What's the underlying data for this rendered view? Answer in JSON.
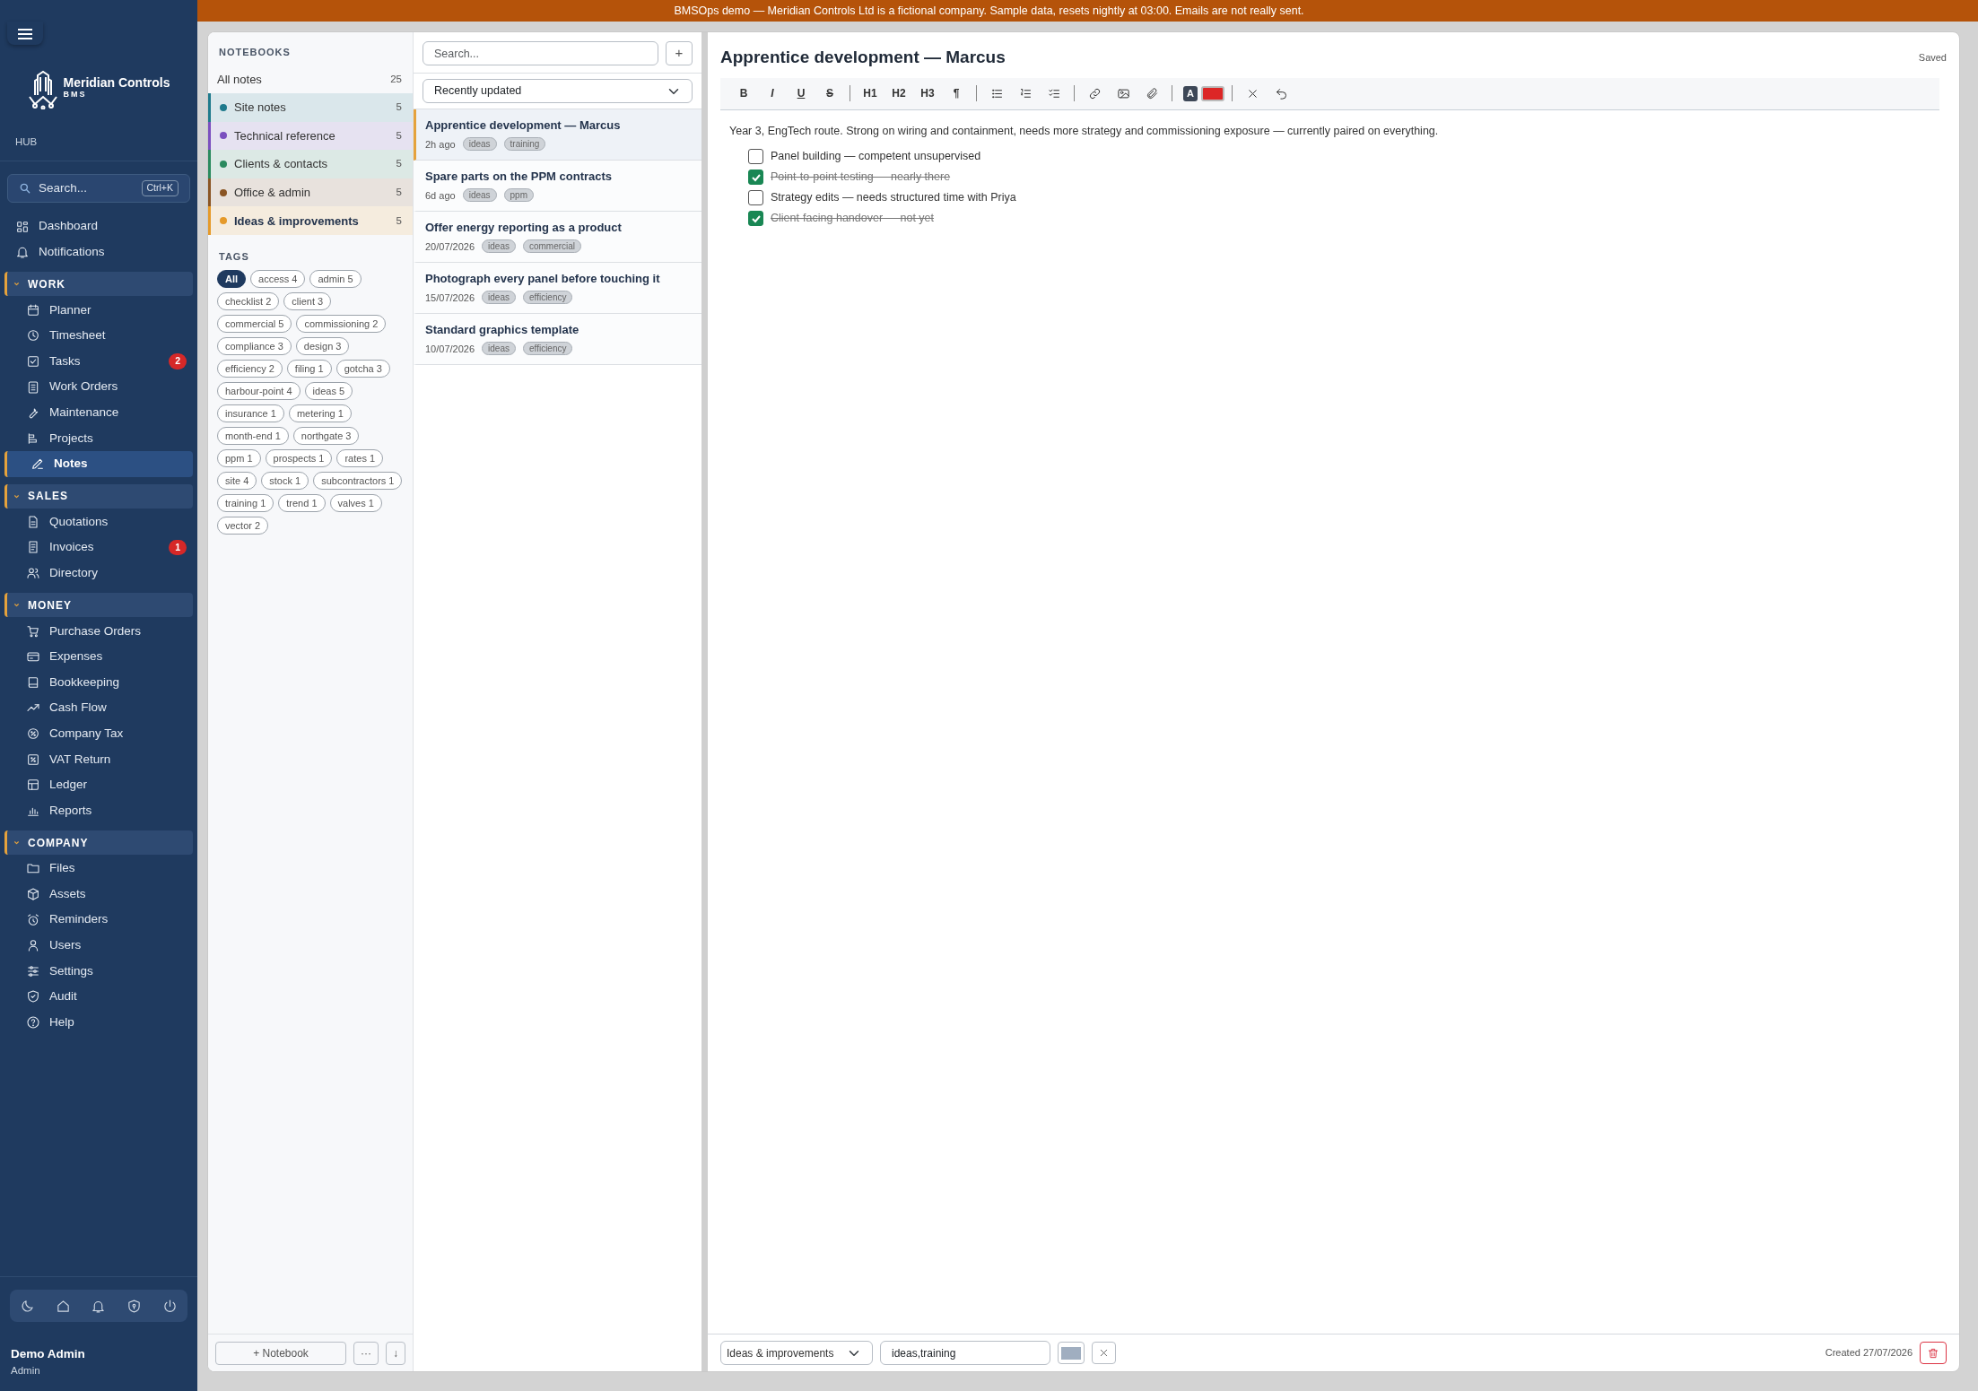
{
  "banner": "BMSOps demo — Meridian Controls Ltd is a fictional company. Sample data, resets nightly at 03:00. Emails are not really sent.",
  "sidebar": {
    "brand": {
      "name": "Meridian Controls",
      "sub": "BMS"
    },
    "hub_label": "HUB",
    "search": {
      "placeholder": "Search...",
      "shortcut": "Ctrl+K"
    },
    "top_items": [
      {
        "label": "Dashboard"
      },
      {
        "label": "Notifications"
      }
    ],
    "sections": [
      {
        "title": "WORK",
        "expanded": true,
        "items": [
          {
            "label": "Planner",
            "selected": false
          },
          {
            "label": "Timesheet",
            "selected": false
          },
          {
            "label": "Tasks",
            "selected": false,
            "badge": "2"
          },
          {
            "label": "Work Orders",
            "selected": false
          },
          {
            "label": "Maintenance",
            "selected": false
          },
          {
            "label": "Projects",
            "selected": false
          },
          {
            "label": "Notes",
            "selected": true
          }
        ]
      },
      {
        "title": "SALES",
        "expanded": true,
        "items": [
          {
            "label": "Quotations",
            "selected": false
          },
          {
            "label": "Invoices",
            "selected": false,
            "badge": "1"
          },
          {
            "label": "Directory",
            "selected": false
          }
        ]
      },
      {
        "title": "MONEY",
        "expanded": true,
        "items": [
          {
            "label": "Purchase Orders",
            "selected": false
          },
          {
            "label": "Expenses",
            "selected": false
          },
          {
            "label": "Bookkeeping",
            "selected": false
          },
          {
            "label": "Cash Flow",
            "selected": false
          },
          {
            "label": "Company Tax",
            "selected": false
          },
          {
            "label": "VAT Return",
            "selected": false
          },
          {
            "label": "Ledger",
            "selected": false
          },
          {
            "label": "Reports",
            "selected": false
          }
        ]
      },
      {
        "title": "COMPANY",
        "expanded": true,
        "items": [
          {
            "label": "Files",
            "selected": false
          },
          {
            "label": "Assets",
            "selected": false
          },
          {
            "label": "Reminders",
            "selected": false
          },
          {
            "label": "Users",
            "selected": false
          },
          {
            "label": "Settings",
            "selected": false
          },
          {
            "label": "Audit",
            "selected": false
          },
          {
            "label": "Help",
            "selected": false
          }
        ]
      }
    ],
    "user": {
      "name": "Demo Admin",
      "role": "Admin"
    }
  },
  "notebooks": {
    "heading": "NOTEBOOKS",
    "all": {
      "label": "All notes",
      "count": "25",
      "selected": false
    },
    "items": [
      {
        "label": "Site notes",
        "count": "5",
        "color": "#1f7a8c",
        "selected": false
      },
      {
        "label": "Technical reference",
        "count": "5",
        "color": "#7b4fbf",
        "selected": false
      },
      {
        "label": "Clients & contacts",
        "count": "5",
        "color": "#2a8a5e",
        "selected": false
      },
      {
        "label": "Office & admin",
        "count": "5",
        "color": "#8a5524",
        "selected": false
      },
      {
        "label": "Ideas & improvements",
        "count": "5",
        "color": "#e59a2a",
        "selected": true
      }
    ],
    "tags_heading": "TAGS",
    "tags": [
      {
        "label": "All",
        "selected": true
      },
      {
        "label": "access 4",
        "selected": false
      },
      {
        "label": "admin 5",
        "selected": false
      },
      {
        "label": "checklist 2",
        "selected": false
      },
      {
        "label": "client 3",
        "selected": false
      },
      {
        "label": "commercial 5",
        "selected": false
      },
      {
        "label": "commissioning 2",
        "selected": false
      },
      {
        "label": "compliance 3",
        "selected": false
      },
      {
        "label": "design 3",
        "selected": false
      },
      {
        "label": "efficiency 2",
        "selected": false
      },
      {
        "label": "filing 1",
        "selected": false
      },
      {
        "label": "gotcha 3",
        "selected": false
      },
      {
        "label": "harbour-point 4",
        "selected": false
      },
      {
        "label": "ideas 5",
        "selected": false
      },
      {
        "label": "insurance 1",
        "selected": false
      },
      {
        "label": "metering 1",
        "selected": false
      },
      {
        "label": "month-end 1",
        "selected": false
      },
      {
        "label": "northgate 3",
        "selected": false
      },
      {
        "label": "ppm 1",
        "selected": false
      },
      {
        "label": "prospects 1",
        "selected": false
      },
      {
        "label": "rates 1",
        "selected": false
      },
      {
        "label": "site 4",
        "selected": false
      },
      {
        "label": "stock 1",
        "selected": false
      },
      {
        "label": "subcontractors 1",
        "selected": false
      },
      {
        "label": "training 1",
        "selected": false
      },
      {
        "label": "trend 1",
        "selected": false
      },
      {
        "label": "valves 1",
        "selected": false
      },
      {
        "label": "vector 2",
        "selected": false
      }
    ],
    "footer_buttons": [
      "+ Notebook",
      "···",
      "↓"
    ]
  },
  "notes": {
    "search": {
      "placeholder": "Search..."
    },
    "add_button": "+",
    "sort": "Recently updated",
    "items": [
      {
        "title": "Apprentice development — Marcus",
        "time": "2h ago",
        "tags": [
          "ideas",
          "training"
        ],
        "selected": true
      },
      {
        "title": "Spare parts on the PPM contracts",
        "time": "6d ago",
        "tags": [
          "ideas",
          "ppm"
        ],
        "selected": false
      },
      {
        "title": "Offer energy reporting as a product",
        "time": "20/07/2026",
        "tags": [
          "ideas",
          "commercial"
        ],
        "selected": false
      },
      {
        "title": "Photograph every panel before touching it",
        "time": "15/07/2026",
        "tags": [
          "ideas",
          "efficiency"
        ],
        "selected": false
      },
      {
        "title": "Standard graphics template",
        "time": "10/07/2026",
        "tags": [
          "ideas",
          "efficiency"
        ],
        "selected": false
      }
    ]
  },
  "editor": {
    "title": "Apprentice development — Marcus",
    "status": "Saved",
    "toolbar": [
      {
        "kind": "text",
        "label": "B"
      },
      {
        "kind": "text",
        "label": "I"
      },
      {
        "kind": "text",
        "label": "U"
      },
      {
        "kind": "text",
        "label": "S"
      },
      {
        "kind": "separator"
      },
      {
        "kind": "text",
        "label": "H1"
      },
      {
        "kind": "text",
        "label": "H2"
      },
      {
        "kind": "text",
        "label": "H3"
      },
      {
        "kind": "text",
        "label": "¶"
      },
      {
        "kind": "separator"
      },
      {
        "kind": "icon"
      },
      {
        "kind": "icon"
      },
      {
        "kind": "icon"
      },
      {
        "kind": "separator"
      },
      {
        "kind": "icon"
      },
      {
        "kind": "icon"
      },
      {
        "kind": "icon"
      },
      {
        "kind": "separator"
      },
      {
        "kind": "text-color",
        "label": "A"
      },
      {
        "kind": "color",
        "color": "#dc2626"
      },
      {
        "kind": "separator"
      },
      {
        "kind": "icon"
      },
      {
        "kind": "icon"
      }
    ],
    "paragraph": "Year 3, EngTech route. Strong on wiring and containment, needs more strategy and commissioning exposure — currently paired on everything.",
    "checklist": [
      {
        "text": "Panel building — competent unsupervised",
        "checked": false
      },
      {
        "text": "Point-to-point testing — nearly there",
        "checked": true
      },
      {
        "text": "Strategy edits — needs structured time with Priya",
        "checked": false
      },
      {
        "text": "Client-facing handover — not yet",
        "checked": true
      }
    ],
    "footer": {
      "notebook": "Ideas & improvements",
      "tags_value": "ideas,training",
      "color": "#a0aec0",
      "created": "Created 27/07/2026"
    }
  }
}
